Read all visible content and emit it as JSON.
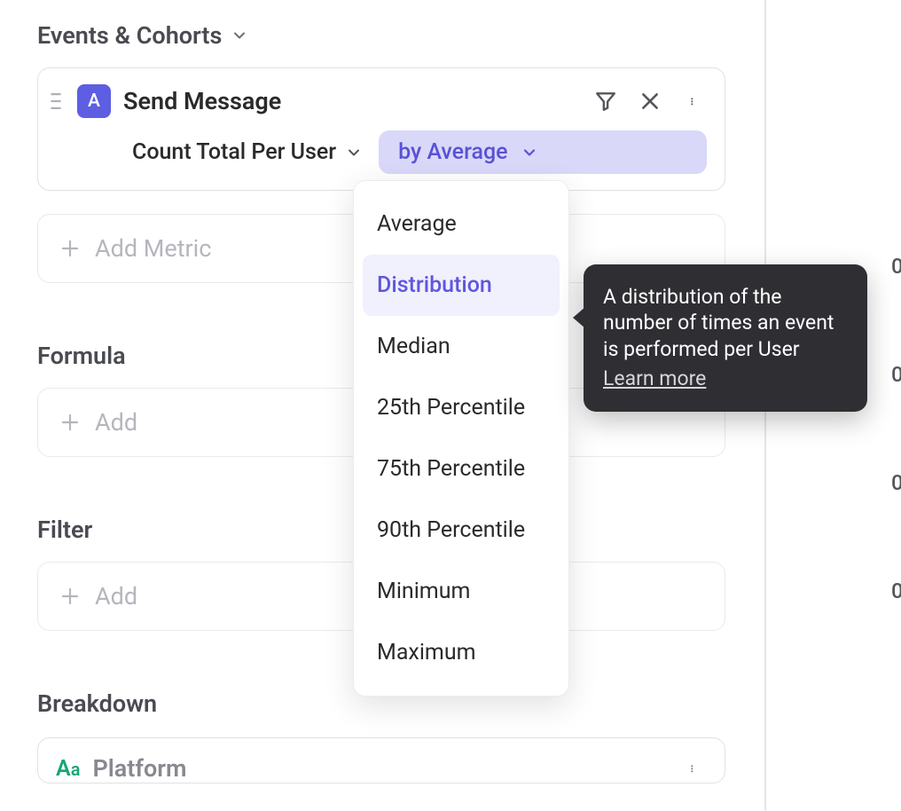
{
  "header": {
    "title": "Events & Cohorts"
  },
  "event": {
    "letter": "A",
    "name": "Send Message",
    "count_option": "Count Total Per User",
    "aggregation_label": "by Average"
  },
  "add_metric_label": "Add Metric",
  "formula": {
    "title": "Formula",
    "add_label": "Add"
  },
  "filter": {
    "title": "Filter",
    "add_label": "Add"
  },
  "breakdown": {
    "title": "Breakdown",
    "icon_text_big": "A",
    "icon_text_small": "a",
    "name": "Platform"
  },
  "dropdown": {
    "items": [
      "Average",
      "Distribution",
      "Median",
      "25th Percentile",
      "75th Percentile",
      "90th Percentile",
      "Minimum",
      "Maximum"
    ],
    "highlighted_index": 1
  },
  "tooltip": {
    "text": "A distribution of the number of times an event is performed per User",
    "learn_more": "Learn more"
  },
  "axis_markers": [
    "0",
    "0",
    "0",
    "0"
  ]
}
